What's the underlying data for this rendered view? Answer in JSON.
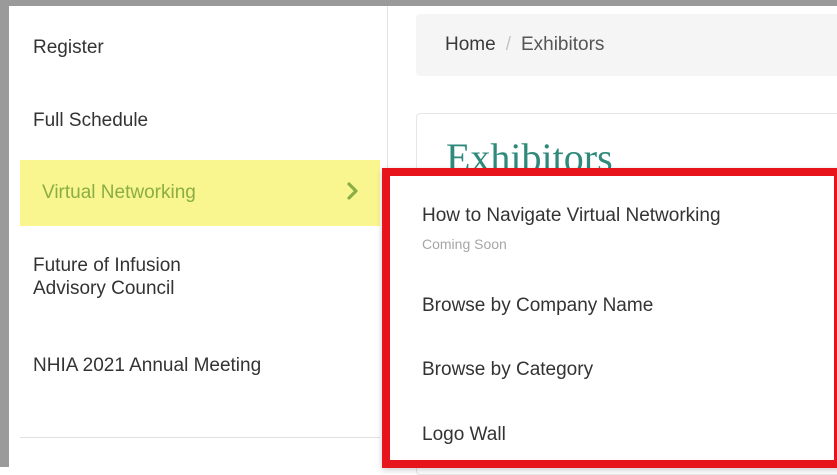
{
  "sidebar": {
    "items": [
      {
        "label": "Register"
      },
      {
        "label": "Full Schedule"
      },
      {
        "label": "Virtual Networking",
        "active": true
      },
      {
        "label_line1": "Future of Infusion",
        "label_line2": "Advisory Council"
      },
      {
        "label": "NHIA 2021 Annual Meeting"
      }
    ],
    "chevron_icon": "chevron-right-icon",
    "active_bg": "#faf68f",
    "active_text": "#8aae44"
  },
  "breadcrumb": {
    "home": "Home",
    "separator": "/",
    "current": "Exhibitors"
  },
  "page": {
    "title": "Exhibitors",
    "title_color": "#2f8a7c"
  },
  "submenu": {
    "border_color": "#e8141c",
    "items": [
      {
        "label": "How to Navigate Virtual Networking",
        "sublabel": "Coming Soon"
      },
      {
        "label": "Browse by Company Name"
      },
      {
        "label": "Browse by Category"
      },
      {
        "label": "Logo Wall"
      }
    ]
  }
}
